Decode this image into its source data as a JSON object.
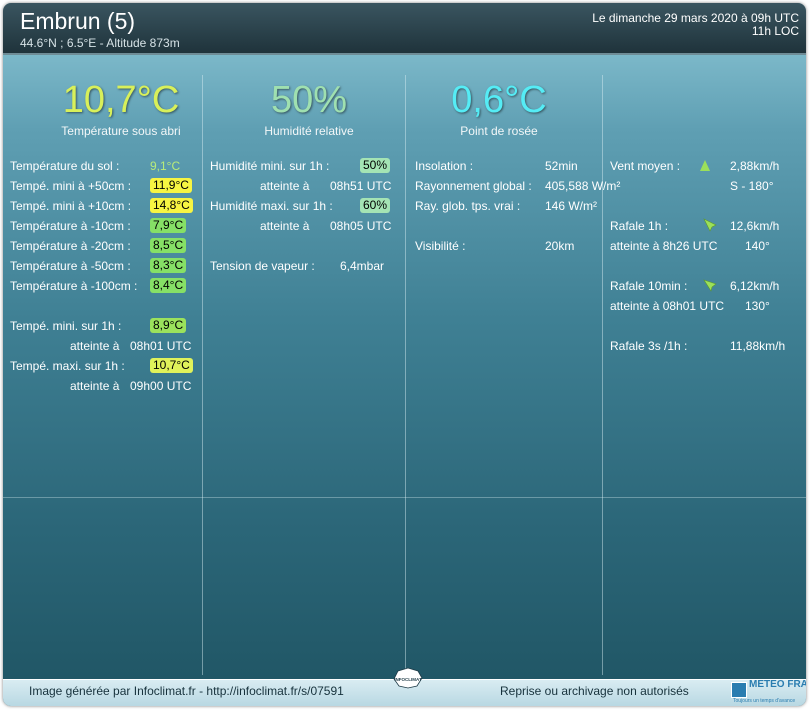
{
  "header": {
    "station": "Embrun (5)",
    "coords": "44.6°N ; 6.5°E - Altitude 873m",
    "date_line1": "Le dimanche 29 mars 2020 à 09h UTC",
    "date_line2": "11h LOC"
  },
  "highlights": {
    "temperature": {
      "value": "10,7°C",
      "caption": "Température sous abri",
      "color": "#d8f05a"
    },
    "humidity": {
      "value": "50%",
      "caption": "Humidité relative",
      "color": "#9fe0b0"
    },
    "dewpoint": {
      "value": "0,6°C",
      "caption": "Point de rosée",
      "color": "#55ecf5"
    }
  },
  "col1": {
    "sol": {
      "label": "Température du sol :",
      "value": "9,1°C",
      "color": "#b8ec7a"
    },
    "p50": {
      "label": "Tempé. mini à +50cm :",
      "value": "11,9°C",
      "color": "#f7f542"
    },
    "p10": {
      "label": "Tempé. mini à +10cm :",
      "value": "14,8°C",
      "color": "#f7f542"
    },
    "m10": {
      "label": "Température à -10cm :",
      "value": "7,9°C",
      "color": "#86e066"
    },
    "m20": {
      "label": "Température à -20cm :",
      "value": "8,5°C",
      "color": "#86e066"
    },
    "m50": {
      "label": "Température à -50cm :",
      "value": "8,3°C",
      "color": "#86e066"
    },
    "m100": {
      "label": "Température à -100cm :",
      "value": "8,4°C",
      "color": "#86e066"
    },
    "tmin": {
      "label": "Tempé. mini. sur 1h :",
      "value": "8,9°C",
      "color": "#9be25c",
      "reached_label": "atteinte à",
      "reached_time": "08h01 UTC"
    },
    "tmax": {
      "label": "Tempé. maxi. sur 1h :",
      "value": "10,7°C",
      "color": "#e0f25a",
      "reached_label": "atteinte à",
      "reached_time": "09h00 UTC"
    }
  },
  "col2": {
    "hmin": {
      "label": "Humidité mini. sur 1h :",
      "value": "50%",
      "color": "#a4e4b4",
      "reached_label": "atteinte à",
      "reached_time": "08h51 UTC"
    },
    "hmax": {
      "label": "Humidité maxi. sur 1h :",
      "value": "60%",
      "color": "#a4e4b4",
      "reached_label": "atteinte à",
      "reached_time": "08h05 UTC"
    },
    "vapor": {
      "label": "Tension de vapeur :",
      "value": "6,4mbar"
    }
  },
  "col3": {
    "insolation": {
      "label": "Insolation :",
      "value": "52min"
    },
    "global_rad": {
      "label": "Rayonnement global :",
      "value": "405,588 W/m²"
    },
    "true_rad": {
      "label": "Ray. glob. tps. vrai :",
      "value": "146 W/m²"
    },
    "visibility": {
      "label": "Visibilité :",
      "value": "20km"
    }
  },
  "col4": {
    "wind_mean": {
      "label": "Vent moyen :",
      "speed": "2,88km/h",
      "direction": "S - 180°"
    },
    "gust_1h": {
      "label": "Rafale 1h :",
      "speed": "12,6km/h",
      "reached": "atteinte à 8h26 UTC",
      "direction": "140°"
    },
    "gust_10min": {
      "label": "Rafale 10min :",
      "speed": "6,12km/h",
      "reached": "atteinte à 08h01 UTC",
      "direction": "130°"
    },
    "gust_3s": {
      "label": "Rafale 3s /1h :",
      "speed": "11,88km/h"
    }
  },
  "footer": {
    "left": "Image générée par Infoclimat.fr - http://infoclimat.fr/s/07591",
    "right": "Reprise ou archivage non autorisés",
    "logo_mf": "METEO FRANCE",
    "logo_mf_tag": "Toujours un temps d'avance",
    "logo_ic": "INFOCLIMAT"
  }
}
